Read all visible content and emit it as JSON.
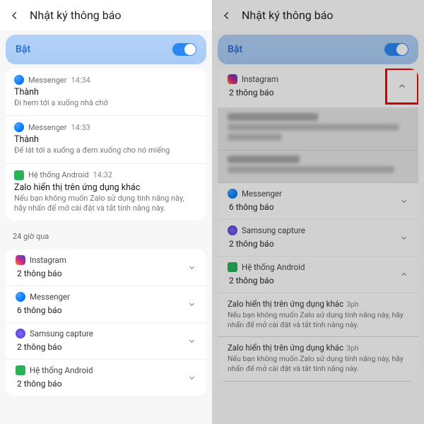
{
  "header": {
    "title": "Nhật ký thông báo"
  },
  "toggle": {
    "label": "Bật",
    "state": true
  },
  "left": {
    "notifs": [
      {
        "app": "Messenger",
        "time": "14:34",
        "title": "Thành",
        "body": "Đi hem tới a xuống nhà chở",
        "icon": "messenger"
      },
      {
        "app": "Messenger",
        "time": "14:33",
        "title": "Thành",
        "body": "Để lát tới a xuống a đem xuống cho nó miếng",
        "icon": "messenger"
      },
      {
        "app": "Hệ thống Android",
        "time": "14:32",
        "title": "Zalo hiển thị trên ứng dụng khác",
        "body": "Nếu bạn không muốn Zalo sử dụng tính năng này, hãy nhấn để mở cài đặt và tắt tính năng này.",
        "icon": "android"
      }
    ],
    "section": "24 giờ qua",
    "summary": [
      {
        "app": "Instagram",
        "count": "2 thông báo",
        "icon": "instagram"
      },
      {
        "app": "Messenger",
        "count": "6 thông báo",
        "icon": "messenger"
      },
      {
        "app": "Samsung capture",
        "count": "2 thông báo",
        "icon": "samsung"
      },
      {
        "app": "Hệ thống Android",
        "count": "2 thông báo",
        "icon": "android"
      }
    ]
  },
  "right": {
    "expanded": {
      "app": "Instagram",
      "count": "2 thông báo",
      "icon": "instagram"
    },
    "summary": [
      {
        "app": "Messenger",
        "count": "6 thông báo",
        "icon": "messenger"
      },
      {
        "app": "Samsung capture",
        "count": "2 thông báo",
        "icon": "samsung"
      },
      {
        "app": "Hệ thống Android",
        "count": "2 thông báo",
        "icon": "android"
      }
    ],
    "zalo": {
      "title": "Zalo hiển thị trên ứng dụng khác",
      "time": "3ph",
      "body": "Nếu bạn không muốn Zalo sử dụng tính năng này, hãy nhấn để mở cài đặt và tắt tính năng này."
    }
  }
}
